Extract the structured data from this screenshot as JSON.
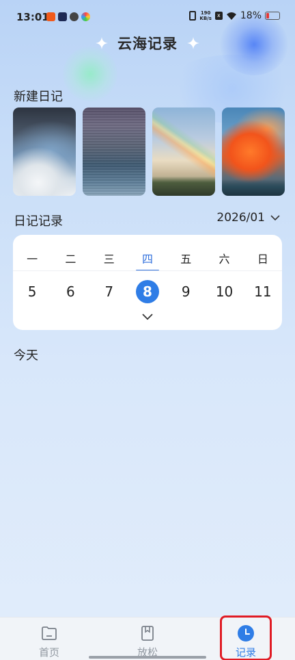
{
  "status_bar": {
    "time": "13:01",
    "net_speed_value": "190",
    "net_speed_unit": "KB/s",
    "battery": "18%",
    "x_badge": "x"
  },
  "header": {
    "title": "云海记录"
  },
  "new_diary": {
    "label": "新建日记",
    "photos": [
      "cloudy-sky",
      "dusk-sea",
      "rainbow-mountain",
      "sunset-cloud"
    ]
  },
  "diary_records": {
    "label": "日记记录",
    "month": "2026/01"
  },
  "calendar": {
    "weekdays": [
      "一",
      "二",
      "三",
      "四",
      "五",
      "六",
      "日"
    ],
    "days": [
      "5",
      "6",
      "7",
      "8",
      "9",
      "10",
      "11"
    ],
    "selected_index": 3
  },
  "today": {
    "label": "今天"
  },
  "bottom_nav": {
    "items": [
      {
        "label": "首页",
        "icon": "folder-icon"
      },
      {
        "label": "放松",
        "icon": "book-icon"
      },
      {
        "label": "记录",
        "icon": "clock-icon"
      }
    ],
    "active_index": 2
  },
  "colors": {
    "accent": "#2f7de6",
    "highlight": "#e01b24"
  }
}
